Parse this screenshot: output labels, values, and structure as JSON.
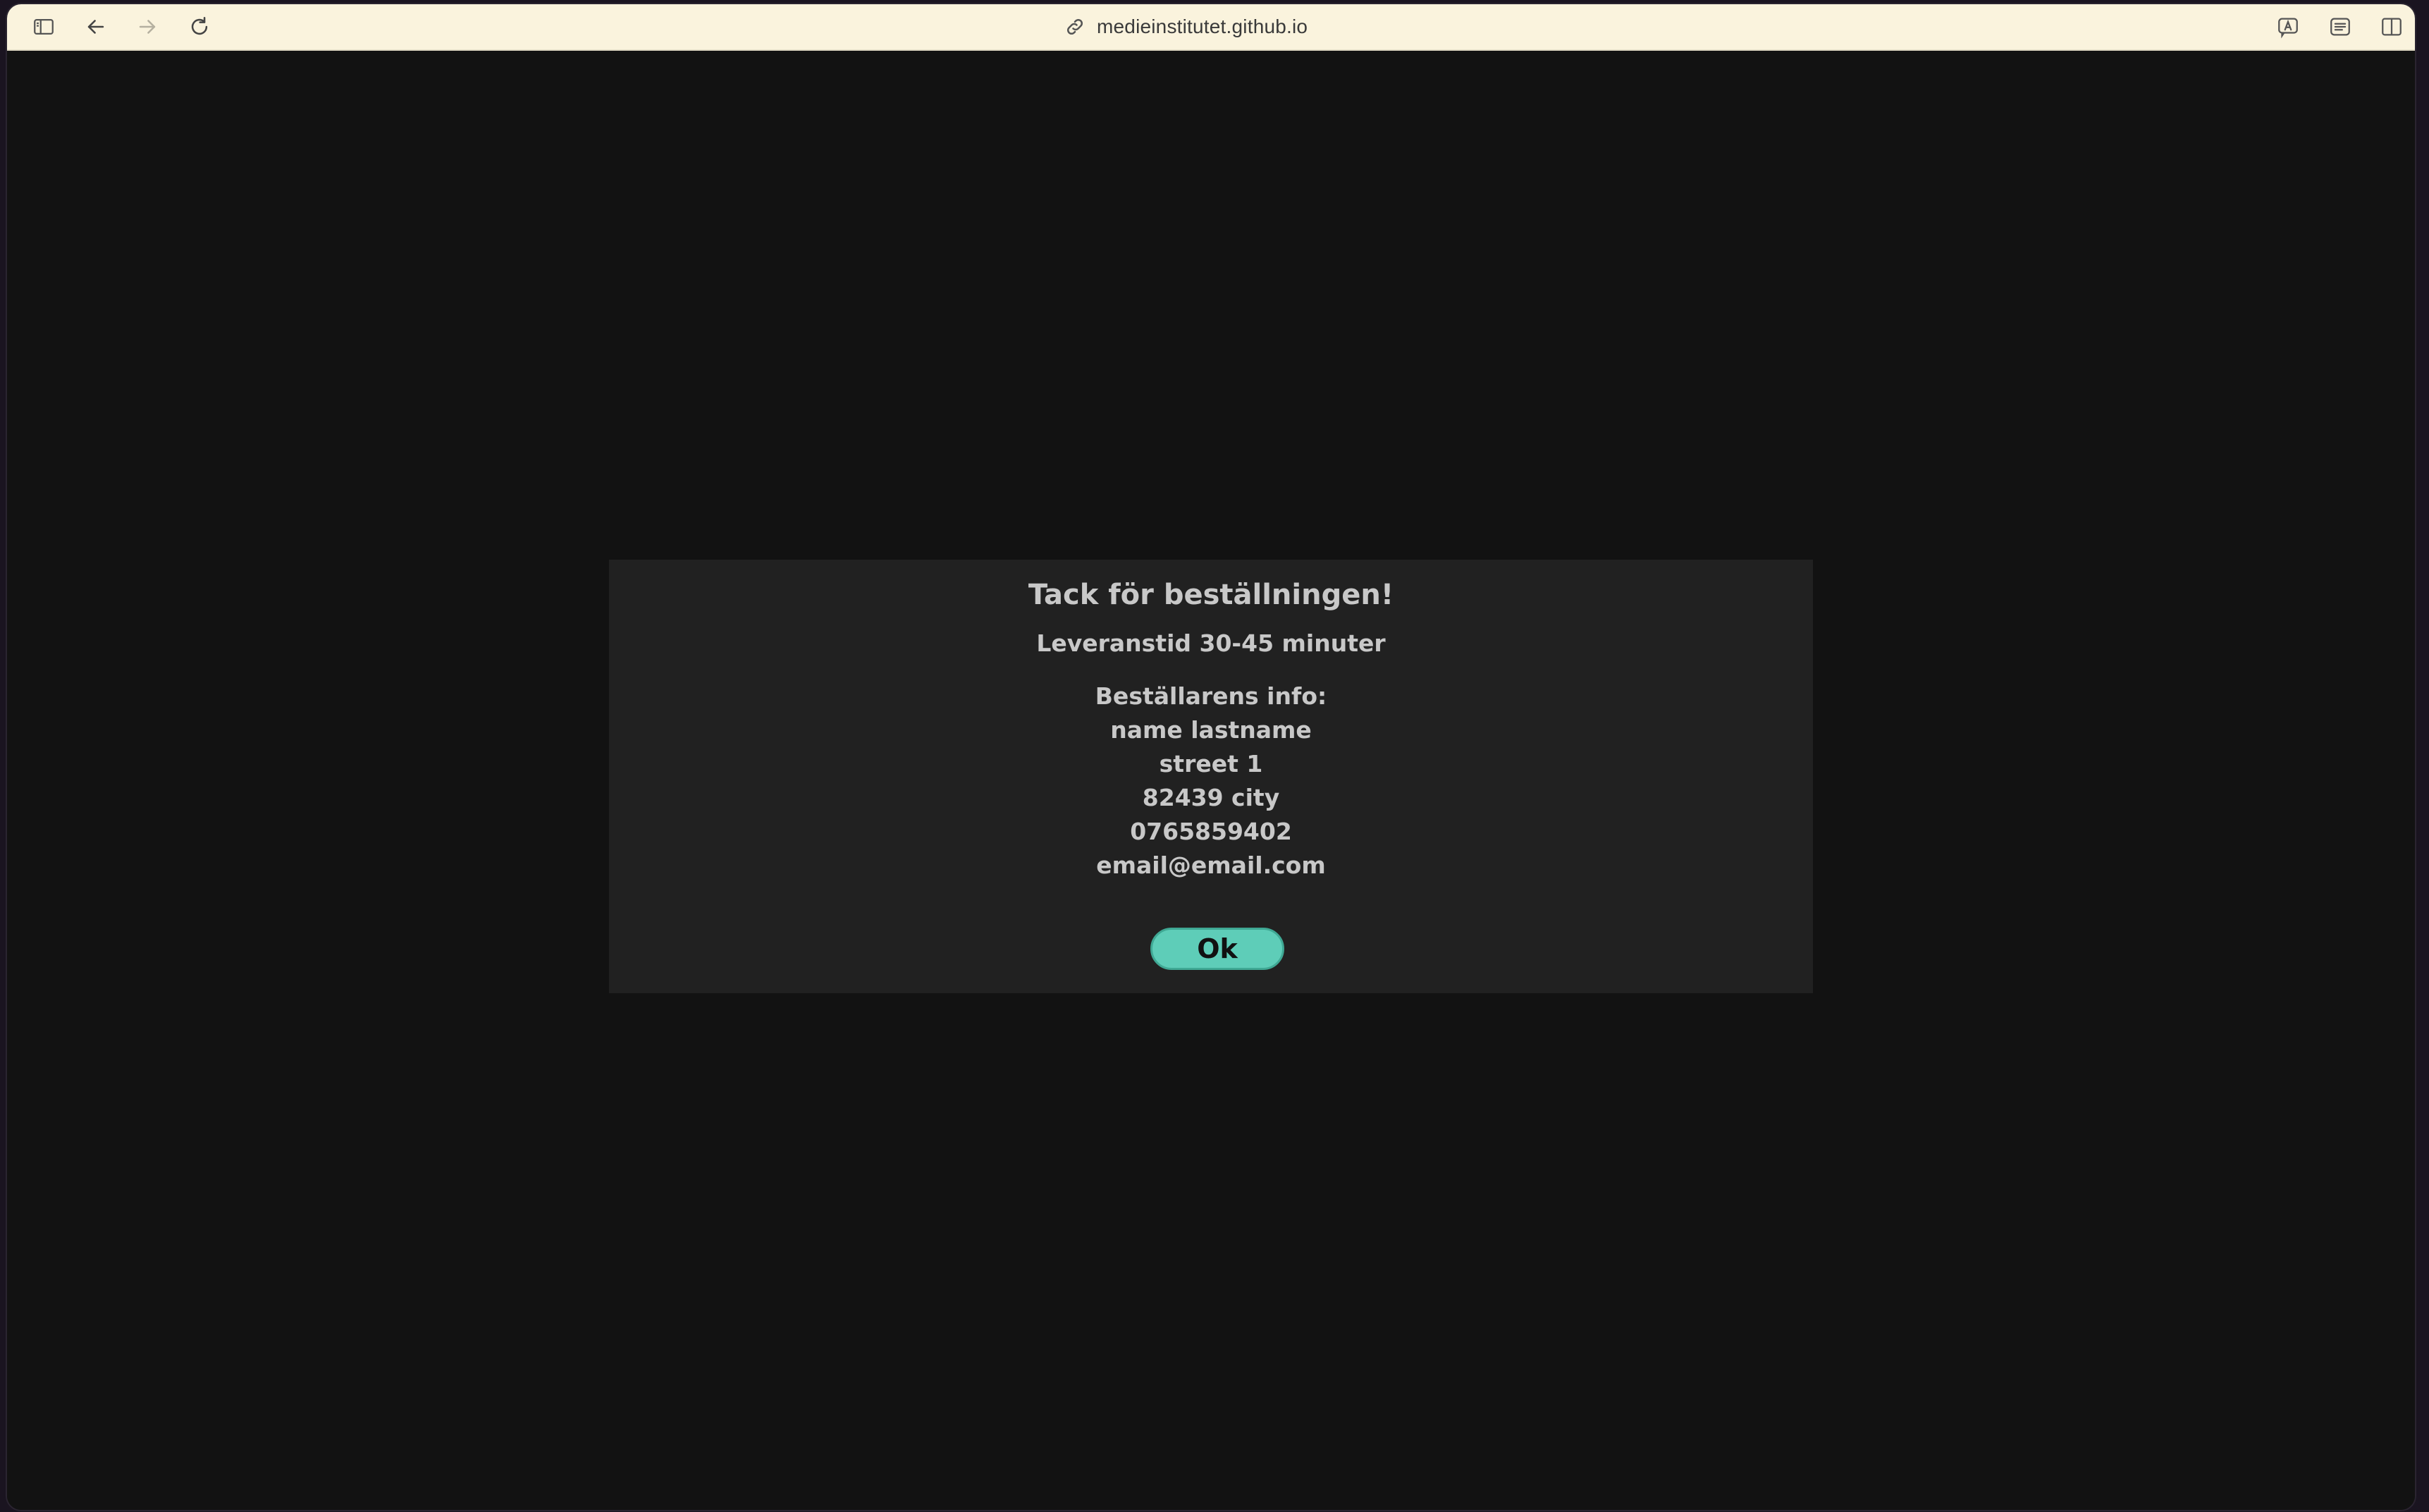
{
  "browser": {
    "url": "medieinstitutet.github.io",
    "icons": [
      "sidebar-icon",
      "back-arrow-icon",
      "forward-arrow-icon",
      "reload-icon",
      "link-icon",
      "translate-icon",
      "reader-icon",
      "split-view-icon"
    ]
  },
  "dialog": {
    "title": "Tack för beställningen!",
    "delivery": "Leveranstid 30-45 minuter",
    "info_heading": "Beställarens info:",
    "name": "name lastname",
    "street": "street 1",
    "postal_city": "82439 city",
    "phone": "0765859402",
    "email": "email@email.com",
    "ok_label": "Ok"
  },
  "colors": {
    "toolbar_bg": "#faf3dd",
    "page_bg": "#121212",
    "dialog_bg": "#212121",
    "text": "#c8c8c8",
    "ok_button": "#5ecdb8"
  }
}
